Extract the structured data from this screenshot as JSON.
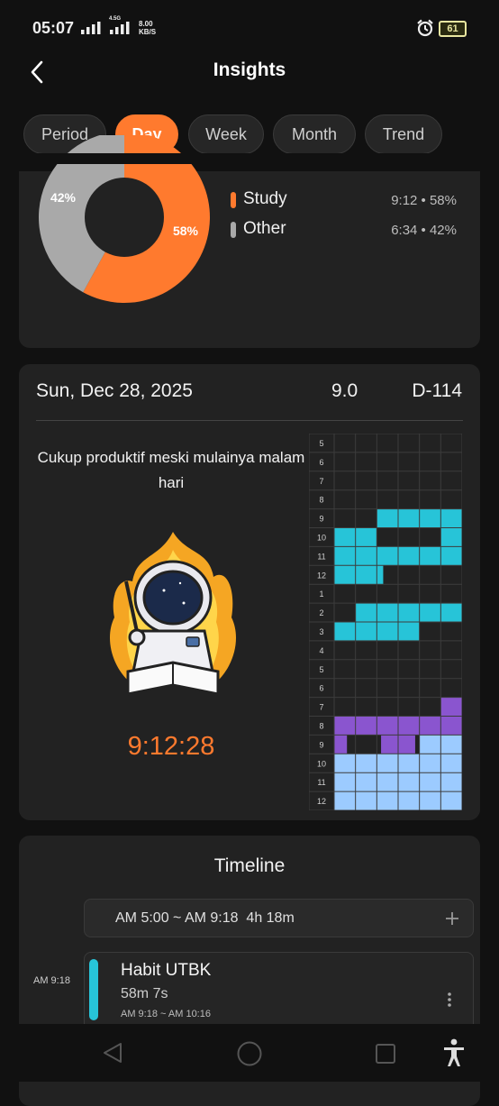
{
  "status_bar": {
    "time": "05:07",
    "network_label": "4.5G",
    "speed_value": "8.00",
    "speed_unit": "KB/S",
    "battery": "61",
    "icons": [
      "signal-icon",
      "signal-4g-icon",
      "alarm-icon",
      "battery-icon"
    ]
  },
  "header": {
    "title": "Insights",
    "back_icon": "chevron-left-icon"
  },
  "tabs": [
    {
      "label": "Period",
      "active": false
    },
    {
      "label": "Day",
      "active": true
    },
    {
      "label": "Week",
      "active": false
    },
    {
      "label": "Month",
      "active": false
    },
    {
      "label": "Trend",
      "active": false
    }
  ],
  "pie": {
    "slices": [
      {
        "name": "Study",
        "label": "58%",
        "value": 58,
        "color": "#ff7a2e"
      },
      {
        "name": "Other",
        "label": "42%",
        "value": 42,
        "color": "#a9a9a9"
      }
    ],
    "legend": [
      {
        "label": "Study",
        "value": "9:12 • 58%",
        "color": "#ff7a2e"
      },
      {
        "label": "Other",
        "value": "6:34 • 42%",
        "color": "#a9a9a9"
      }
    ]
  },
  "day": {
    "date": "Sun, Dec 28, 2025",
    "score": "9.0",
    "dday": "D-114",
    "quote": "Cukup produktif meski mulainya malam hari",
    "timer": "9:12:28",
    "illustration": "astronaut-studying-illustration",
    "hour_labels": [
      "5",
      "6",
      "7",
      "8",
      "9",
      "10",
      "11",
      "12",
      "1",
      "2",
      "3",
      "4",
      "5",
      "6",
      "7",
      "8",
      "9",
      "10",
      "11",
      "12"
    ],
    "colors": {
      "cyan": "#27c4d8",
      "purple": "#8a55cf",
      "blue": "#9ccbff",
      "grid": "#3c3c3c"
    },
    "blocks": [
      {
        "hour": 9,
        "from": 2,
        "to": 6,
        "color": "cyan"
      },
      {
        "hour": 10,
        "from": 0,
        "to": 2,
        "color": "cyan"
      },
      {
        "hour": 10,
        "from": 5,
        "to": 6,
        "color": "cyan"
      },
      {
        "hour": 11,
        "from": 0,
        "to": 6,
        "color": "cyan"
      },
      {
        "hour": 12,
        "from": 0,
        "to": 2.3,
        "color": "cyan"
      },
      {
        "hour": 14,
        "from": 1,
        "to": 6,
        "color": "cyan"
      },
      {
        "hour": 15,
        "from": 0,
        "to": 4,
        "color": "cyan"
      },
      {
        "hour": 19,
        "from": 5,
        "to": 6,
        "color": "purple"
      },
      {
        "hour": 20,
        "from": 0,
        "to": 6,
        "color": "purple"
      },
      {
        "hour": 21,
        "from": 0,
        "to": 0.6,
        "color": "purple"
      },
      {
        "hour": 21,
        "from": 2.2,
        "to": 3.8,
        "color": "purple"
      },
      {
        "hour": 21,
        "from": 4,
        "to": 6,
        "color": "blue"
      },
      {
        "hour": 22,
        "from": 0,
        "to": 6,
        "color": "blue"
      },
      {
        "hour": 23,
        "from": 0,
        "to": 6,
        "color": "blue"
      },
      {
        "hour": 24,
        "from": 0,
        "to": 6,
        "color": "blue"
      }
    ]
  },
  "timeline": {
    "title": "Timeline",
    "session": "AM 5:00 ~ AM 9:18  4h 18m",
    "add_icon": "plus-icon",
    "entry": {
      "time": "AM 9:18",
      "title": "Habit UTBK",
      "duration": "58m 7s",
      "range": "AM 9:18 ~ AM 10:16",
      "color": "#27c4d8",
      "menu_icon": "more-vertical-icon"
    }
  },
  "nav": {
    "icons": [
      "back-triangle-icon",
      "home-circle-icon",
      "recents-square-icon",
      "accessibility-icon"
    ]
  }
}
